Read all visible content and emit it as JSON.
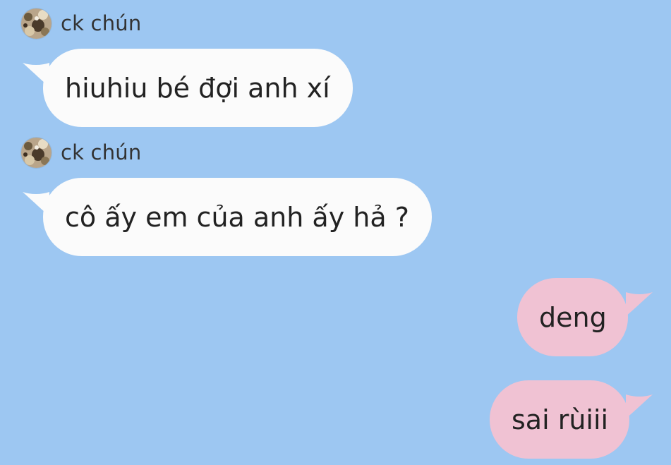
{
  "chat": {
    "messages": [
      {
        "direction": "incoming",
        "sender": "ck chún",
        "text": "hiuhiu bé đợi anh xí"
      },
      {
        "direction": "incoming",
        "sender": "ck chún",
        "text": "cô ấy em của anh ấy hả ?"
      },
      {
        "direction": "outgoing",
        "text": "deng"
      },
      {
        "direction": "outgoing",
        "text": "sai rùiii"
      }
    ]
  },
  "colors": {
    "background": "#9dc7f2",
    "incoming_bubble": "#fbfbfb",
    "outgoing_bubble": "#f0c2d3",
    "text": "#222222"
  },
  "icons": {
    "avatar": "user-avatar-photo"
  }
}
